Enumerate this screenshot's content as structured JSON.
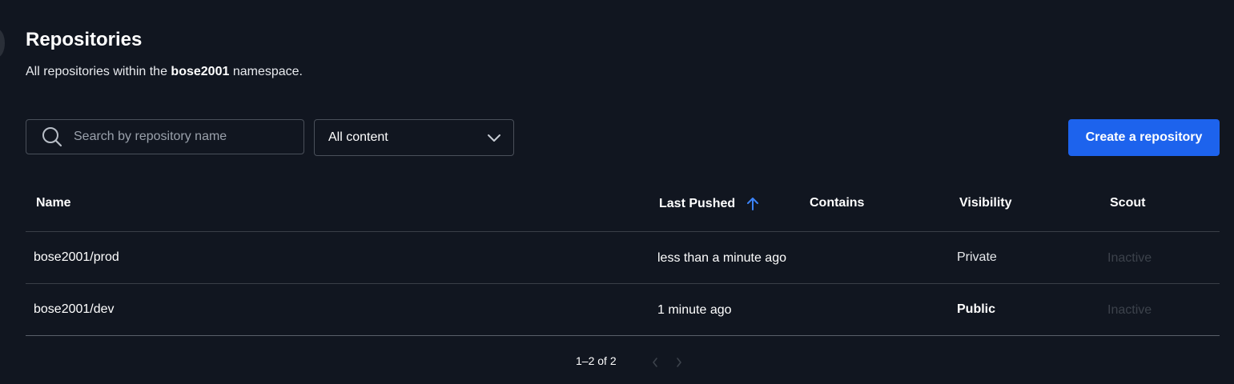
{
  "header": {
    "title": "Repositories",
    "subtitle_prefix": "All repositories within the",
    "namespace": "bose2001",
    "subtitle_suffix": "namespace."
  },
  "toolbar": {
    "search_placeholder": "Search by repository name",
    "content_filter": "All content",
    "create_label": "Create a repository"
  },
  "table": {
    "columns": {
      "name": "Name",
      "last_pushed": "Last Pushed",
      "contains": "Contains",
      "visibility": "Visibility",
      "scout": "Scout"
    },
    "rows": [
      {
        "name": "bose2001/prod",
        "last_pushed": "less than a minute ago",
        "contains": "",
        "visibility": "Private",
        "scout": "Inactive"
      },
      {
        "name": "bose2001/dev",
        "last_pushed": "1 minute ago",
        "contains": "",
        "visibility": "Public",
        "scout": "Inactive"
      }
    ]
  },
  "pagination": {
    "label": "1–2 of 2"
  },
  "colors": {
    "background": "#111620",
    "accent": "#1d63ed",
    "sort_arrow": "#3b82f6"
  },
  "icons": [
    "search-icon",
    "chevron-down-icon",
    "arrow-up-icon",
    "chevron-left-icon",
    "chevron-right-icon"
  ]
}
